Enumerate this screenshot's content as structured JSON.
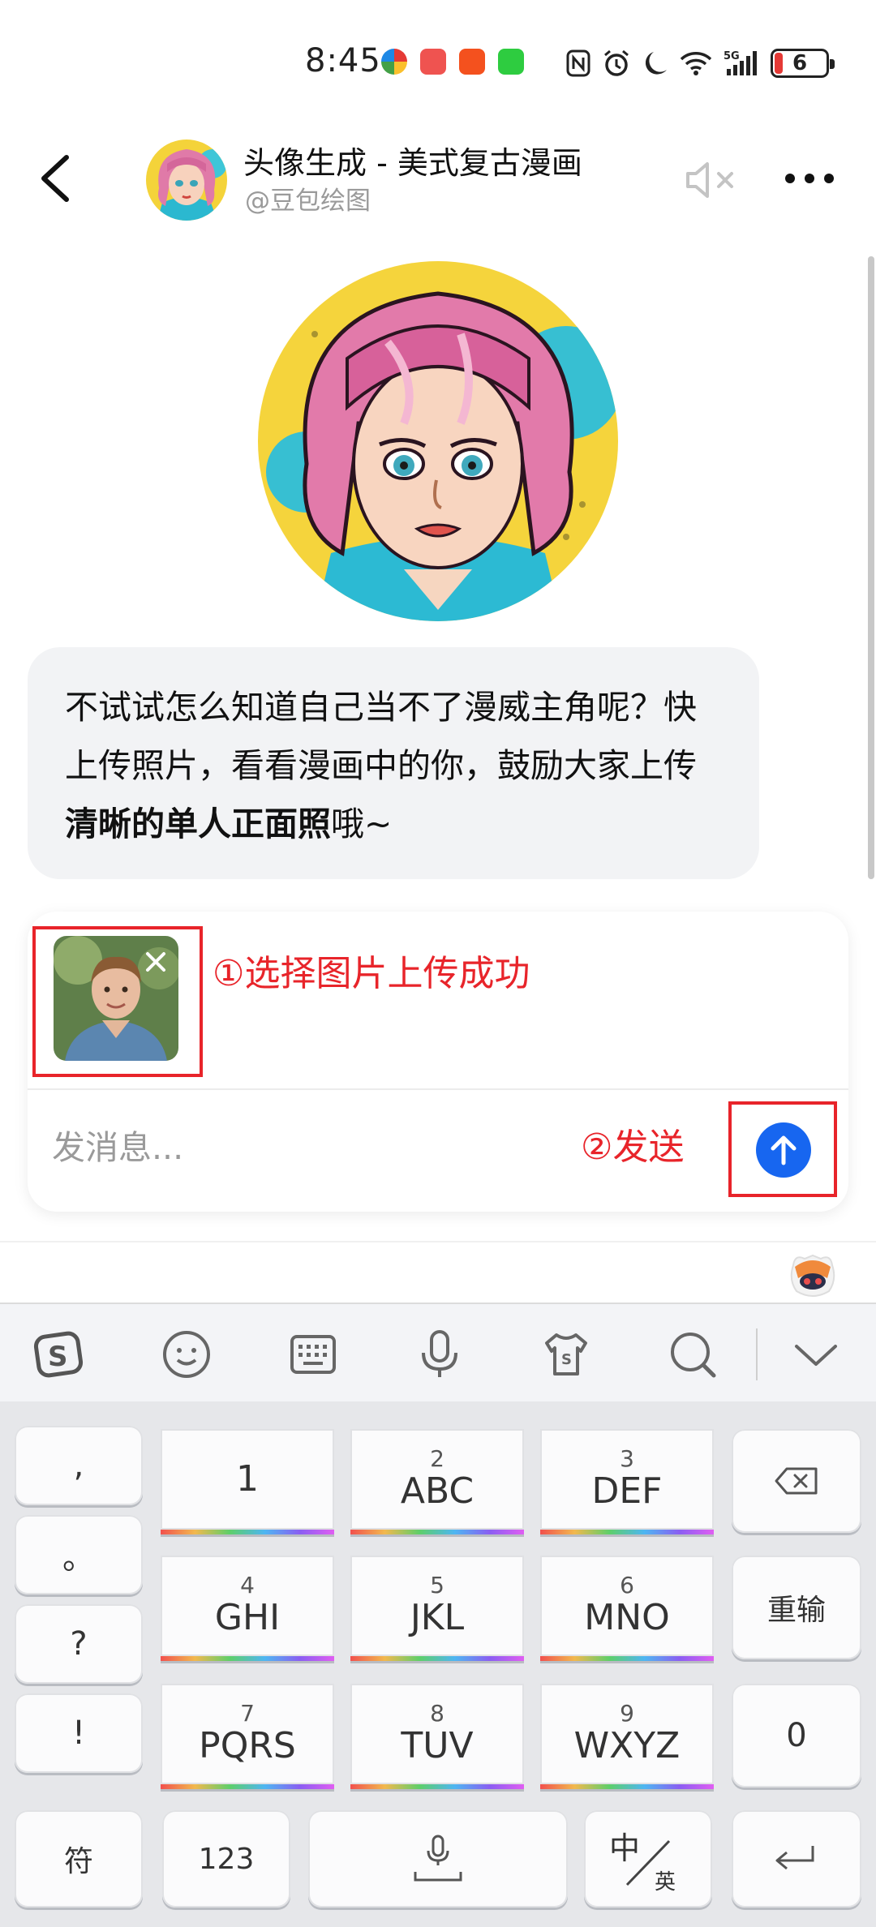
{
  "status_bar": {
    "time": "8:45",
    "battery_level": "6"
  },
  "header": {
    "title": "头像生成 - 美式复古漫画",
    "subtitle": "@豆包绘图"
  },
  "message": {
    "text_plain": "不试试怎么知道自己当不了漫威主角呢？快上传照片，看看漫画中的你，鼓励大家上传",
    "text_bold": "清晰的单人正面照",
    "text_tail": "哦~"
  },
  "composer": {
    "placeholder": "发消息...",
    "annotation_1": "①选择图片上传成功",
    "annotation_2": "②发送"
  },
  "keyboard": {
    "left_column": [
      ",",
      "。",
      "?",
      "!"
    ],
    "keys": [
      {
        "sub": "",
        "main": "1"
      },
      {
        "sub": "2",
        "main": "ABC"
      },
      {
        "sub": "3",
        "main": "DEF"
      },
      {
        "sub": "4",
        "main": "GHI"
      },
      {
        "sub": "5",
        "main": "JKL"
      },
      {
        "sub": "6",
        "main": "MNO"
      },
      {
        "sub": "7",
        "main": "PQRS"
      },
      {
        "sub": "8",
        "main": "TUV"
      },
      {
        "sub": "9",
        "main": "WXYZ"
      }
    ],
    "reenter": "重输",
    "zero": "0",
    "symbols": "符",
    "numbers": "123",
    "lang_main": "中",
    "lang_sub": "英"
  },
  "icons": {
    "back": "chevron-left-icon",
    "mute": "speaker-muted-icon",
    "more": "more-dots-icon",
    "send": "arrow-up-icon",
    "remove": "close-icon",
    "backspace": "backspace-icon",
    "enter": "enter-icon",
    "mic": "mic-icon"
  },
  "colors": {
    "annotation": "#e8242a",
    "send_button": "#1766f0",
    "bubble_bg": "#f2f3f5"
  }
}
